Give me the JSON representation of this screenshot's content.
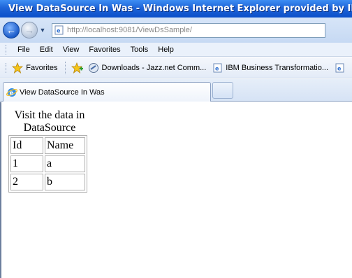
{
  "window": {
    "title": "View DataSource In Was - Windows Internet Explorer provided by IBM"
  },
  "address_bar": {
    "url": "http://localhost:9081/ViewDsSample/"
  },
  "menu": {
    "items": [
      "File",
      "Edit",
      "View",
      "Favorites",
      "Tools",
      "Help"
    ]
  },
  "favorites_bar": {
    "favorites_label": "Favorites",
    "links": [
      "Downloads - Jazz.net Comm...",
      "IBM Business Transformatio..."
    ]
  },
  "tabs": {
    "active_label": "View DataSource In Was"
  },
  "page": {
    "heading": "Visit the data in DataSource",
    "table": {
      "headers": [
        "Id",
        "Name"
      ],
      "rows": [
        [
          "1",
          "a"
        ],
        [
          "2",
          "b"
        ]
      ]
    }
  },
  "colors": {
    "titlebar": "#1e64d8",
    "toolbar": "#d7e5f8"
  }
}
